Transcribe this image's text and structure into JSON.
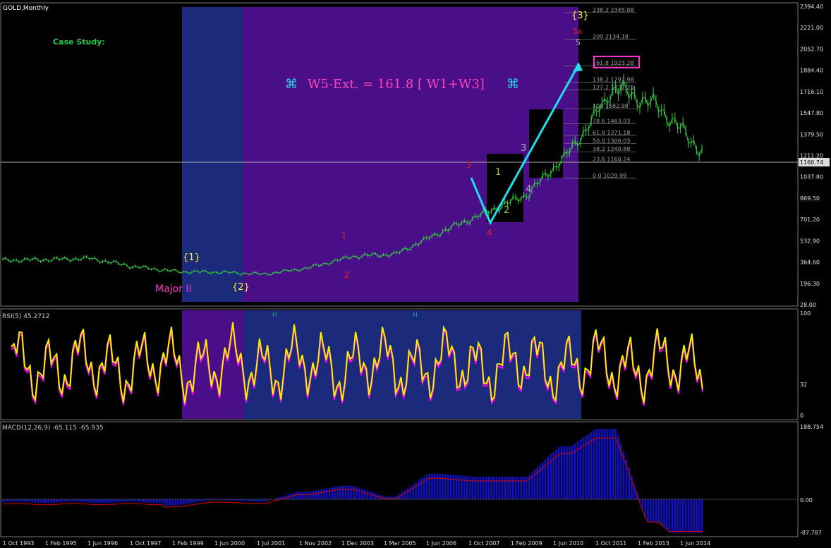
{
  "window": {
    "title": "GOLD,Monthly",
    "case_study": "Case Study:"
  },
  "headline": {
    "text": "W5-Ext. = 161.8 [ W1+W3]",
    "symbol": "⌘"
  },
  "price_axis": [
    "2394.40",
    "2221.00",
    "2052.70",
    "1884.40",
    "1716.10",
    "1547.80",
    "1379.50",
    "1211.20",
    "1037.80",
    "869.50",
    "701.20",
    "532.90",
    "364.60",
    "196.30",
    "28.00"
  ],
  "current_price": "1160.74",
  "fib_levels": [
    {
      "ratio": "238.2",
      "price": "2345.08"
    },
    {
      "ratio": "200",
      "price": "2134.18"
    },
    {
      "ratio": "161.8",
      "price": "1923.28"
    },
    {
      "ratio": "138.2",
      "price": "1792.98"
    },
    {
      "ratio": "127.2",
      "price": "1732.25"
    },
    {
      "ratio": "100",
      "price": "1582.98"
    },
    {
      "ratio": "78.6",
      "price": "1463.03"
    },
    {
      "ratio": "61.8",
      "price": "1371.18"
    },
    {
      "ratio": "50.0",
      "price": "1306.03"
    },
    {
      "ratio": "38.2",
      "price": "1240.88"
    },
    {
      "ratio": "23.6",
      "price": "1160.24"
    },
    {
      "ratio": "0.0",
      "price": "1029.99"
    }
  ],
  "wave_labels": [
    "{1}",
    "{2}",
    "{3}",
    "Major II",
    "5x",
    "1",
    "2",
    "3",
    "4",
    "5"
  ],
  "rsi": {
    "label": "RSI(5) 45.2712",
    "levels": [
      "100",
      "32",
      "0"
    ],
    "h_marker": "H"
  },
  "macd": {
    "label": "MACD(12,26,9) -65.115 -65.935",
    "levels": [
      "188.754",
      "0.00",
      "-87.787"
    ]
  },
  "date_axis": [
    "1 Oct 1993",
    "1 Feb 1995",
    "1 Jun 1996",
    "1 Oct 1997",
    "1 Feb 1999",
    "1 Jun 2000",
    "1 Jul 2001",
    "1 Nov 2002",
    "1 Dec 2003",
    "1 Mar 2005",
    "1 Jun 2006",
    "1 Oct 2007",
    "1 Feb 2009",
    "1 Jun 2010",
    "1 Oct 2011",
    "1 Feb 2013",
    "1 Jun 2014"
  ],
  "chart_data": {
    "type": "line",
    "title": "GOLD,Monthly",
    "x": [
      "1 Oct 1993",
      "1 Feb 1995",
      "1 Jun 1996",
      "1 Oct 1997",
      "1 Feb 1999",
      "1 Jun 2000",
      "1 Jul 2001",
      "1 Nov 2002",
      "1 Dec 2003",
      "1 Mar 2005",
      "1 Jun 2006",
      "1 Oct 2007",
      "1 Feb 2009",
      "1 Jun 2010",
      "1 Oct 2011",
      "1 Feb 2013",
      "1 Jun 2014"
    ],
    "series": [
      {
        "values": [
          380,
          385,
          395,
          330,
          290,
          285,
          270,
          320,
          410,
          430,
          600,
          750,
          900,
          1250,
          1750,
          1600,
          1250
        ]
      }
    ],
    "ylim": [
      28,
      2394.4
    ],
    "colors": {
      "price": "#2ecc40",
      "rsi": "#ffee00",
      "rsi_shadow": "#ff00ff",
      "macd_hist": "#1010d0",
      "macd_signal": "#e00000",
      "arrow": "#22ddee",
      "blue_zone": "#1b2a7a",
      "purple_zone": "#4a0f88"
    }
  }
}
